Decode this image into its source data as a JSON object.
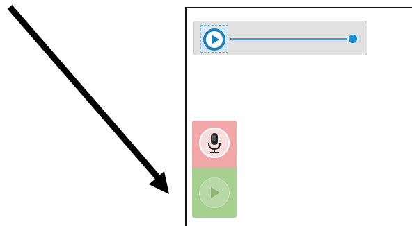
{
  "audio_player": {
    "progress": 1.0,
    "play_icon": "play-icon",
    "accent": "#1f8fcf"
  },
  "record_button": {
    "icon": "microphone-icon",
    "color": "#f1a7a7"
  },
  "playback_button": {
    "icon": "play-icon",
    "color": "#a7cf8f",
    "state": "disabled"
  },
  "annotation": {
    "icon": "arrow-icon",
    "color": "#000000"
  }
}
